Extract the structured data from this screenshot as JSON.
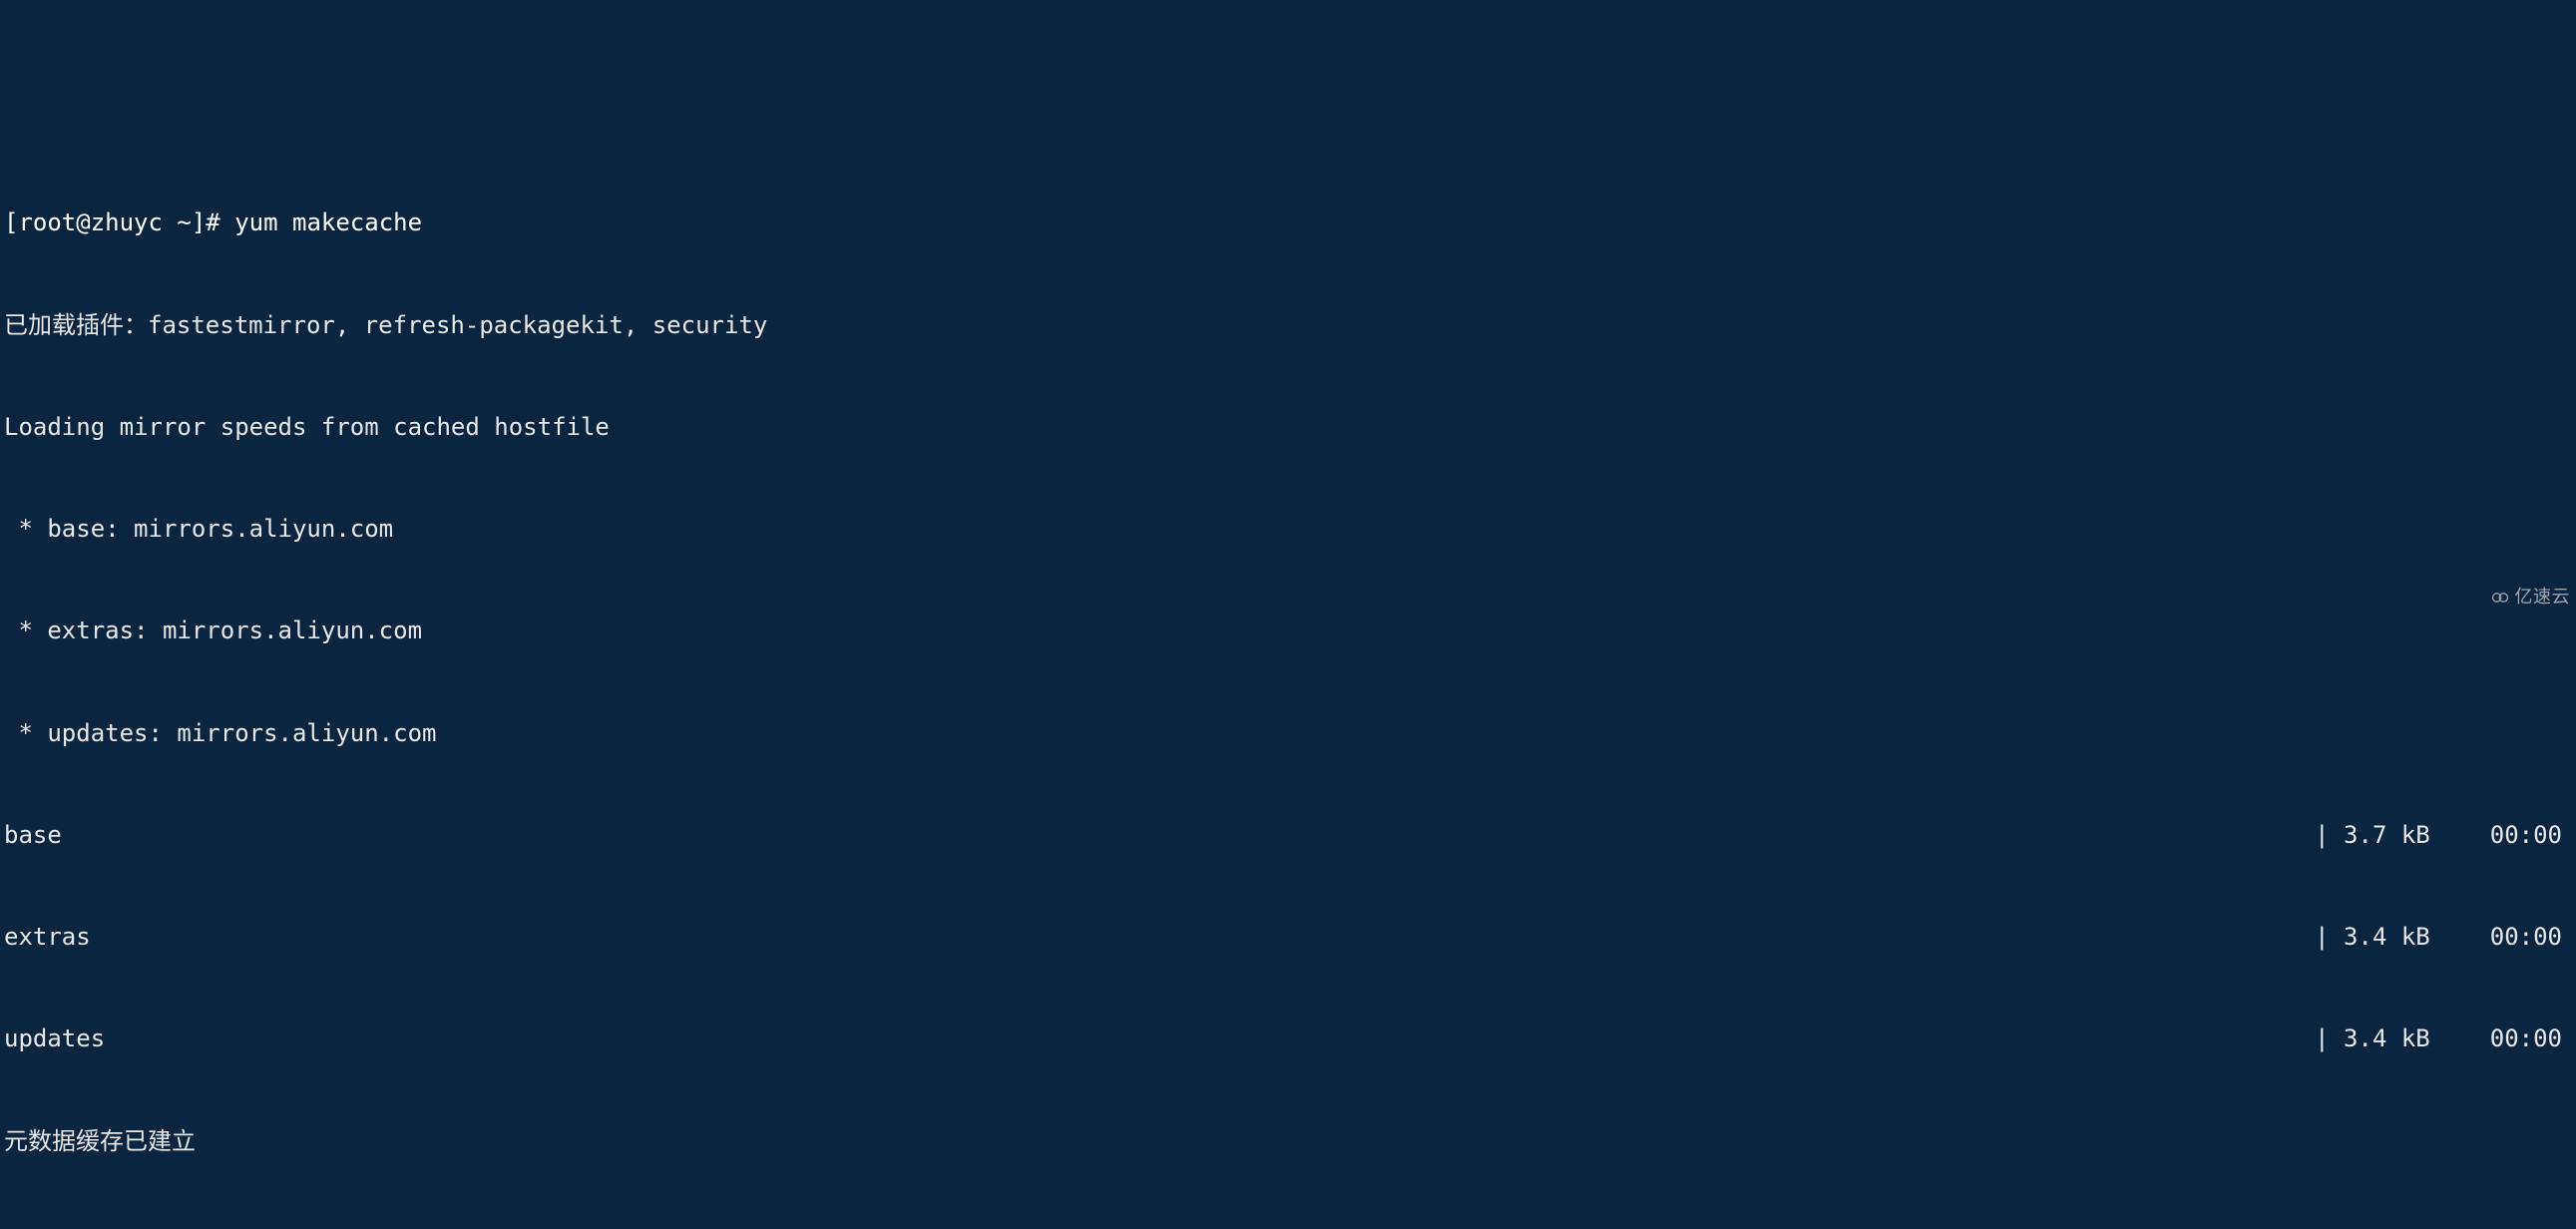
{
  "prompt": {
    "user_host": "[root@zhuyc ~]#",
    "command": "yum makecache"
  },
  "output": {
    "plugins_line": "已加载插件：fastestmirror, refresh-packagekit, security",
    "loading_line": "Loading mirror speeds from cached hostfile",
    "mirrors": [
      " * base: mirrors.aliyun.com",
      " * extras: mirrors.aliyun.com",
      " * updates: mirrors.aliyun.com"
    ],
    "repos": [
      {
        "name": "base",
        "size": "| 3.7 kB",
        "time": "00:00"
      },
      {
        "name": "extras",
        "size": "| 3.4 kB",
        "time": "00:00"
      },
      {
        "name": "updates",
        "size": "| 3.4 kB",
        "time": "00:00"
      }
    ],
    "final_line": "元数据缓存已建立"
  },
  "watermark": {
    "text": "亿速云"
  }
}
